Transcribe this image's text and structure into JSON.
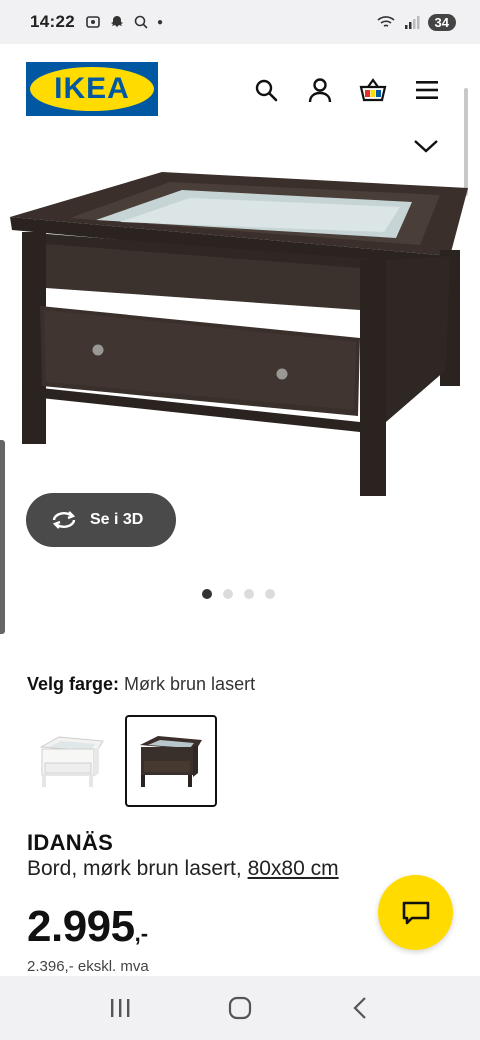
{
  "status_bar": {
    "time": "14:22",
    "battery": "34"
  },
  "brand": {
    "logo_text": "IKEA",
    "colors": {
      "blue": "#0058a3",
      "yellow": "#ffdb00"
    }
  },
  "header": {
    "icons": [
      "search-icon",
      "user-icon",
      "shopping-basket-icon",
      "menu-icon"
    ]
  },
  "gallery": {
    "view_3d_label": "Se i 3D",
    "total_images": 4,
    "active_index": 0
  },
  "color_selector": {
    "label": "Velg farge:",
    "value": "Mørk brun lasert",
    "options": [
      {
        "name": "white",
        "selected": false
      },
      {
        "name": "dark-brown",
        "selected": true
      }
    ]
  },
  "product": {
    "name": "IDANÄS",
    "description": "Bord, mørk brun lasert,",
    "size": "80x80 cm",
    "price_main": "2.995",
    "price_suffix": ",-",
    "price_ex_vat": "2.396,- ekskl. mva"
  }
}
